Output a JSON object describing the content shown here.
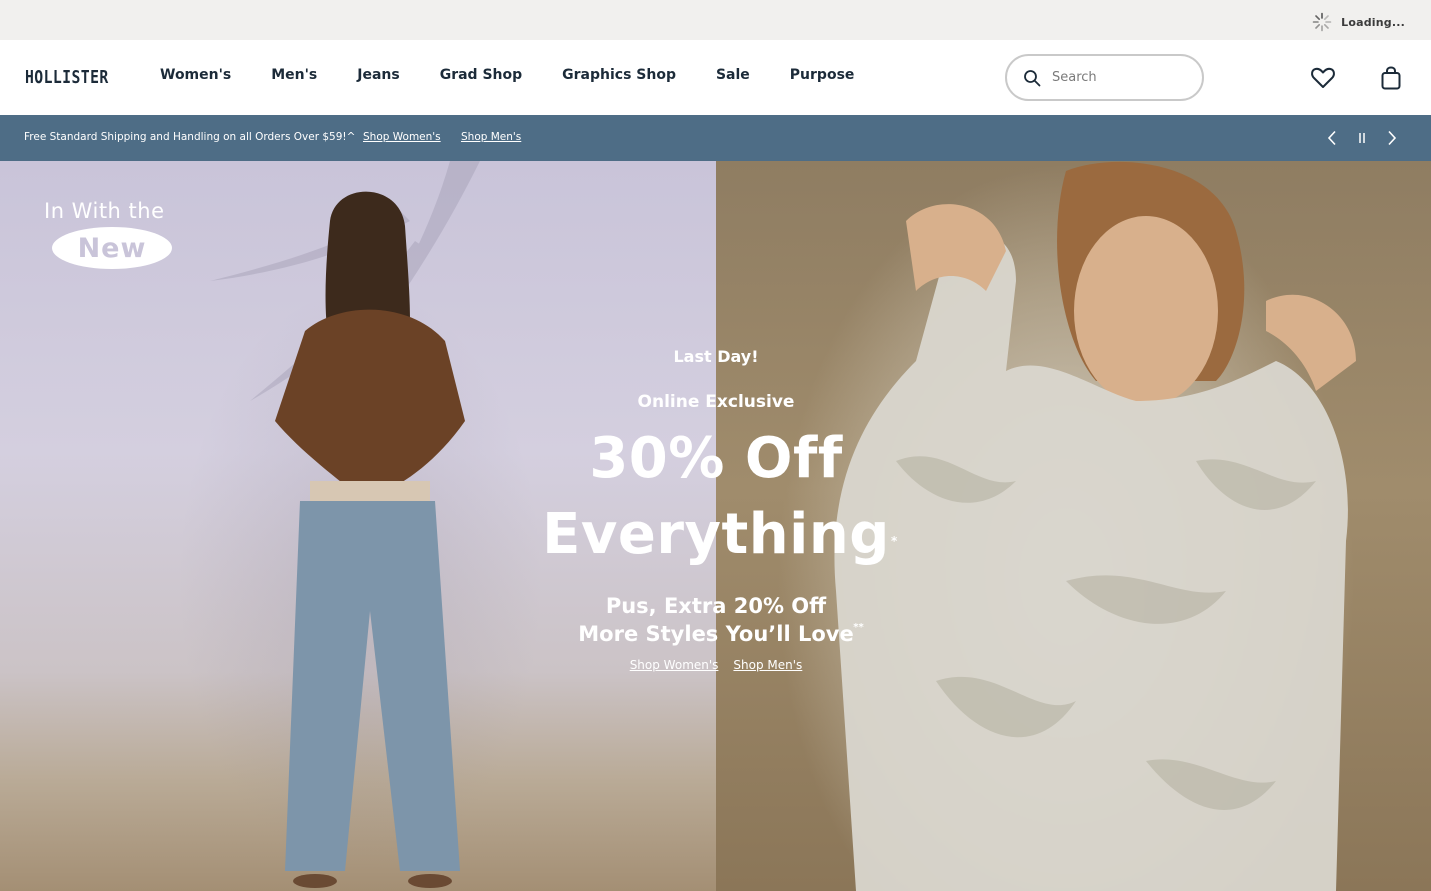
{
  "utility": {
    "loading_text": "Loading..."
  },
  "header": {
    "logo": "HOLLISTER",
    "nav": [
      "Women's",
      "Men's",
      "Jeans",
      "Grad Shop",
      "Graphics Shop",
      "Sale",
      "Purpose"
    ],
    "search_placeholder": "Search",
    "icons": {
      "search": "search-icon",
      "wishlist": "heart-icon",
      "bag": "shopping-bag-icon"
    }
  },
  "promo": {
    "text": "Free Standard Shipping and Handling on all Orders Over $59!^",
    "link_women": "Shop Women's",
    "link_men": "Shop Men's",
    "controls": [
      "chevron-left-icon",
      "pause-icon",
      "chevron-right-icon"
    ]
  },
  "hero": {
    "badge_top": "In With the",
    "badge_new": "New",
    "last_day": "Last Day!",
    "exclusive": "Online Exclusive",
    "headline_1": "30% Off",
    "headline_2": "Everything",
    "headline_mark": "*",
    "sub_1": "Pus, Extra 20% Off",
    "sub_2": "More Styles You’ll Love",
    "sub_mark": "**",
    "link_women": "Shop Women's",
    "link_men": "Shop Men's"
  },
  "colors": {
    "brand_navy": "#1c2b39",
    "promo_bar": "#4e6d86",
    "utility_bar": "#f1f0ee"
  }
}
